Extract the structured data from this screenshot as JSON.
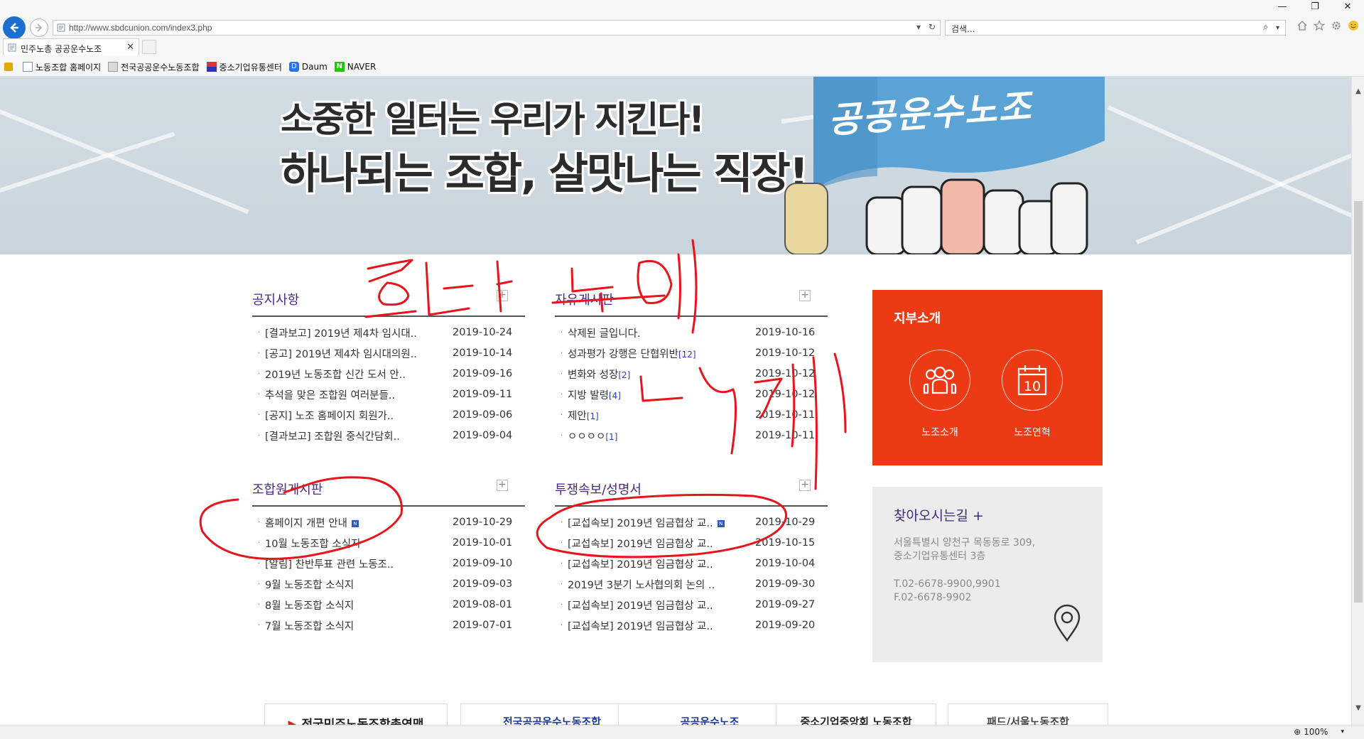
{
  "browser": {
    "url": "http://www.sbdcunion.com/index3.php",
    "search_placeholder": "검색...",
    "tab_title": "민주노총 공공운수노조",
    "favorites": [
      "노동조합 홈페이지",
      "전국공공운수노동조합",
      "중소기업유통센터",
      "Daum",
      "NAVER"
    ],
    "zoom": "100%"
  },
  "banner": {
    "slogan_line1": "소중한 일터는 우리가 지킨다!",
    "slogan_line2": "하나되는 조합, 살맛나는 직장!",
    "flag_text": "공공운수노조"
  },
  "boards": {
    "notice": {
      "title": "공지사항",
      "items": [
        {
          "title": "[결과보고] 2019년 제4차 임시대..",
          "count": "",
          "date": "2019-10-24",
          "new": false
        },
        {
          "title": "[공고] 2019년 제4차 임시대의원..",
          "count": "",
          "date": "2019-10-14",
          "new": false
        },
        {
          "title": "2019년 노동조합 신간 도서 안..",
          "count": "",
          "date": "2019-09-16",
          "new": false
        },
        {
          "title": "추석을 맞은 조합원 여러분들..",
          "count": "",
          "date": "2019-09-11",
          "new": false
        },
        {
          "title": "[공지] 노조 홈페이지 회원가..",
          "count": "",
          "date": "2019-09-06",
          "new": false
        },
        {
          "title": "[결과보고] 조합원 중식간담회..",
          "count": "",
          "date": "2019-09-04",
          "new": false
        }
      ]
    },
    "free": {
      "title": "자유게시판",
      "items": [
        {
          "title": "삭제된 글입니다.",
          "count": "",
          "date": "2019-10-16",
          "new": false
        },
        {
          "title": "성과평가 강행은 단협위반",
          "count": "[12]",
          "date": "2019-10-12",
          "new": false
        },
        {
          "title": "변화와 성장",
          "count": "[2]",
          "date": "2019-10-12",
          "new": false
        },
        {
          "title": "지방 발령",
          "count": "[4]",
          "date": "2019-10-12",
          "new": false
        },
        {
          "title": "제안",
          "count": "[1]",
          "date": "2019-10-11",
          "new": false
        },
        {
          "title": "ㅇㅇㅇㅇ",
          "count": "[1]",
          "date": "2019-10-11",
          "new": false
        }
      ]
    },
    "member": {
      "title": "조합원게시판",
      "items": [
        {
          "title": "홈페이지 개편 안내",
          "count": "",
          "date": "2019-10-29",
          "new": true
        },
        {
          "title": "10월 노동조합 소식지",
          "count": "",
          "date": "2019-10-01",
          "new": false
        },
        {
          "title": "[알림] 찬반투표 관련 노동조..",
          "count": "",
          "date": "2019-09-10",
          "new": false
        },
        {
          "title": "9월 노동조합 소식지",
          "count": "",
          "date": "2019-09-03",
          "new": false
        },
        {
          "title": "8월 노동조합 소식지",
          "count": "",
          "date": "2019-08-01",
          "new": false
        },
        {
          "title": "7월 노동조합 소식지",
          "count": "",
          "date": "2019-07-01",
          "new": false
        }
      ]
    },
    "struggle": {
      "title": "투쟁속보/성명서",
      "items": [
        {
          "title": "[교섭속보] 2019년 임금협상 교..",
          "count": "",
          "date": "2019-10-29",
          "new": true
        },
        {
          "title": "[교섭속보] 2019년 임금협상 교..",
          "count": "",
          "date": "2019-10-15",
          "new": false
        },
        {
          "title": "[교섭속보] 2019년 임금협상 교..",
          "count": "",
          "date": "2019-10-04",
          "new": false
        },
        {
          "title": "2019년 3분기 노사협의회 논의 ..",
          "count": "",
          "date": "2019-09-30",
          "new": false
        },
        {
          "title": "[교섭속보] 2019년 임금협상 교..",
          "count": "",
          "date": "2019-09-27",
          "new": false
        },
        {
          "title": "[교섭속보] 2019년 임금협상 교..",
          "count": "",
          "date": "2019-09-20",
          "new": false
        }
      ]
    }
  },
  "branch_intro": {
    "title": "지부소개",
    "btn1": "노조소개",
    "btn2": "노조연혁",
    "calendar_day": "10"
  },
  "directions": {
    "title": "찾아오시는길 +",
    "address1": "서울특별시 양천구 목동동로 309,",
    "address2": "중소기업유통센터 3층",
    "tel": "T.02-6678-9900,9901",
    "fax": "F.02-6678-9902"
  },
  "partners": [
    "전국민주노동조합총연맹",
    "전국공공운수노동조합",
    "공공운수노조",
    "중소기업중앙회 노동조합",
    "패드/서울노동조합"
  ],
  "colors": {
    "accent_red": "#ec3b14",
    "title_purple": "#4a2a80",
    "annotation_red": "#e8141c"
  }
}
